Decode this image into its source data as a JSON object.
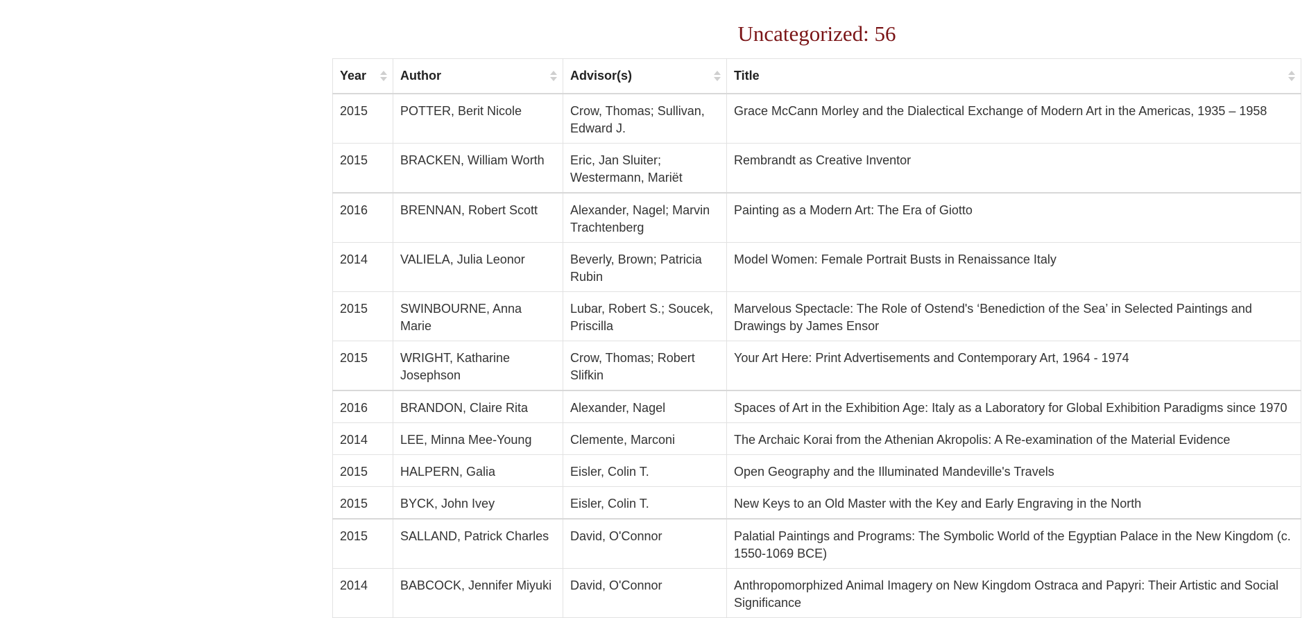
{
  "heading": "Uncategorized: 56",
  "columns": [
    {
      "label": "Year"
    },
    {
      "label": "Author"
    },
    {
      "label": "Advisor(s)"
    },
    {
      "label": "Title"
    }
  ],
  "rows": [
    {
      "year": "2015",
      "author": "POTTER, Berit Nicole",
      "advisors": "Crow, Thomas; Sullivan, Edward J.",
      "title": "Grace McCann Morley and the Dialectical Exchange of Modern Art in the Americas, 1935 – 1958"
    },
    {
      "year": "2015",
      "author": "BRACKEN, William Worth",
      "advisors": "Eric, Jan Sluiter; Westermann, Mariët",
      "title": "Rembrandt as Creative Inventor"
    },
    {
      "year": "2016",
      "author": "BRENNAN, Robert Scott",
      "advisors": "Alexander, Nagel; Marvin Trachtenberg",
      "title": "Painting as a Modern Art: The Era of Giotto"
    },
    {
      "year": "2014",
      "author": "VALIELA, Julia Leonor",
      "advisors": "Beverly, Brown; Patricia Rubin",
      "title": "Model Women: Female Portrait Busts in Renaissance Italy"
    },
    {
      "year": "2015",
      "author": "SWINBOURNE, Anna Marie",
      "advisors": "Lubar, Robert S.; Soucek, Priscilla",
      "title": "Marvelous Spectacle: The Role of Ostend's ‘Benediction of the Sea’ in Selected Paintings and Drawings by James Ensor"
    },
    {
      "year": "2015",
      "author": "WRIGHT, Katharine Josephson",
      "advisors": "Crow, Thomas; Robert Slifkin",
      "title": "Your Art Here: Print Advertisements and Contemporary Art, 1964 - 1974"
    },
    {
      "year": "2016",
      "author": "BRANDON, Claire Rita",
      "advisors": "Alexander, Nagel",
      "title": "Spaces of Art in the Exhibition Age: Italy as a Laboratory for Global Exhibition Paradigms since 1970"
    },
    {
      "year": "2014",
      "author": "LEE, Minna Mee-Young",
      "advisors": "Clemente, Marconi",
      "title": "The Archaic Korai from the Athenian Akropolis: A Re-examination of the Material Evidence"
    },
    {
      "year": "2015",
      "author": "HALPERN, Galia",
      "advisors": "Eisler, Colin T.",
      "title": "Open Geography and the Illuminated Mandeville's Travels"
    },
    {
      "year": "2015",
      "author": "BYCK, John Ivey",
      "advisors": "Eisler, Colin T.",
      "title": "New Keys to an Old Master with the Key and Early Engraving in the North"
    },
    {
      "year": "2015",
      "author": "SALLAND, Patrick Charles",
      "advisors": "David, O'Connor",
      "title": "Palatial Paintings and Programs: The Symbolic World of the Egyptian Palace in the New Kingdom (c. 1550-1069 BCE)"
    },
    {
      "year": "2014",
      "author": "BABCOCK, Jennifer Miyuki",
      "advisors": "David, O'Connor",
      "title": "Anthropomorphized Animal Imagery on New Kingdom Ostraca and Papyri: Their Artistic and Social Significance"
    }
  ],
  "group_start_rows": [
    2,
    6,
    10
  ],
  "icons": {
    "sort": "sort-both-icon"
  },
  "colors": {
    "heading": "#7a1416",
    "text": "#333333",
    "border": "#e2e2e2",
    "sort_arrows": "#cfcfcf"
  }
}
